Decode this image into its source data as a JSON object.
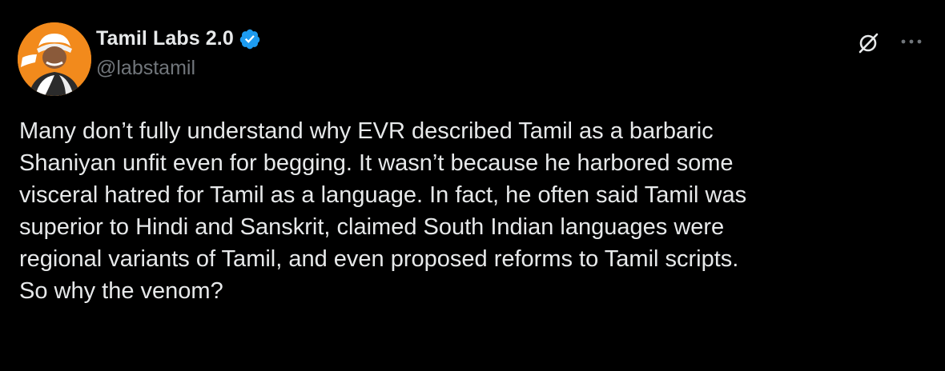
{
  "author": {
    "display_name": "Tamil Labs 2.0",
    "handle": "@labstamil",
    "verified": true,
    "avatar_icon": "avatar-portrait-icon",
    "avatar_bg": "#f28a1c"
  },
  "actions": {
    "grok_icon": "grok-icon",
    "more_icon": "more-icon"
  },
  "tweet": {
    "text": "Many don’t fully understand why EVR described Tamil as a barbaric\nShaniyan unfit even for begging. It wasn’t because he harbored some\nvisceral hatred for Tamil as a language. In fact, he often said Tamil was\nsuperior to Hindi and Sanskrit, claimed South Indian languages were\nregional variants of Tamil, and even proposed reforms to Tamil scripts.\nSo why the venom?"
  },
  "colors": {
    "background": "#000000",
    "text": "#e7e9ea",
    "muted": "#71767b",
    "verified_badge": "#1d9bf0"
  }
}
